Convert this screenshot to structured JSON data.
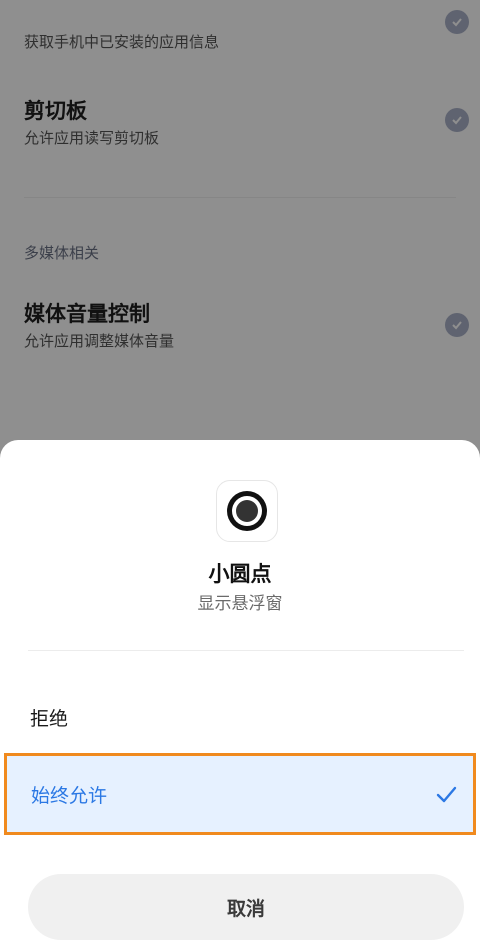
{
  "background": {
    "items": [
      {
        "title": "",
        "desc": "获取手机中已安装的应用信息"
      },
      {
        "title": "剪切板",
        "desc": "允许应用读写剪切板"
      },
      {
        "title": "媒体音量控制",
        "desc": "允许应用调整媒体音量"
      }
    ],
    "section_label": "多媒体相关"
  },
  "sheet": {
    "app_name": "小圆点",
    "permission": "显示悬浮窗",
    "options": {
      "deny": "拒绝",
      "always_allow": "始终允许"
    },
    "cancel": "取消"
  },
  "colors": {
    "accent": "#2b78e4",
    "highlight_border": "#f08a1e",
    "selected_bg": "#e6f1ff"
  },
  "icons": {
    "app": "circle-dot-icon",
    "check": "check-icon",
    "granted": "shield-check-icon"
  }
}
